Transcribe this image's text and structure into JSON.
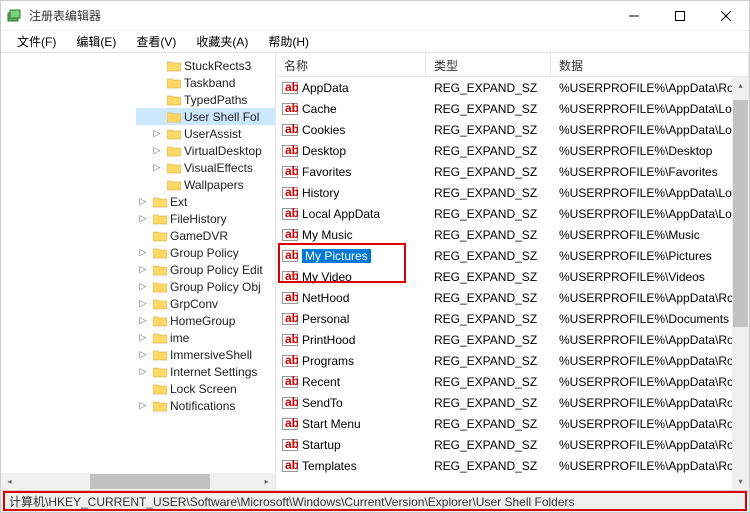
{
  "window": {
    "title": "注册表编辑器"
  },
  "menu": {
    "file": "文件(F)",
    "edit": "编辑(E)",
    "view": "查看(V)",
    "favorites": "收藏夹(A)",
    "help": "帮助(H)"
  },
  "tree": {
    "items": [
      {
        "label": "StuckRects3",
        "expandable": false,
        "indent": 2
      },
      {
        "label": "Taskband",
        "expandable": false,
        "indent": 2
      },
      {
        "label": "TypedPaths",
        "expandable": false,
        "indent": 2
      },
      {
        "label": "User Shell Fol",
        "expandable": false,
        "indent": 2,
        "selected": true
      },
      {
        "label": "UserAssist",
        "expandable": true,
        "indent": 2
      },
      {
        "label": "VirtualDesktop",
        "expandable": true,
        "indent": 2
      },
      {
        "label": "VisualEffects",
        "expandable": true,
        "indent": 2
      },
      {
        "label": "Wallpapers",
        "expandable": false,
        "indent": 2
      },
      {
        "label": "Ext",
        "expandable": true,
        "indent": 1
      },
      {
        "label": "FileHistory",
        "expandable": true,
        "indent": 1
      },
      {
        "label": "GameDVR",
        "expandable": false,
        "indent": 1
      },
      {
        "label": "Group Policy",
        "expandable": true,
        "indent": 1
      },
      {
        "label": "Group Policy Edit",
        "expandable": true,
        "indent": 1
      },
      {
        "label": "Group Policy Obj",
        "expandable": true,
        "indent": 1
      },
      {
        "label": "GrpConv",
        "expandable": true,
        "indent": 1
      },
      {
        "label": "HomeGroup",
        "expandable": true,
        "indent": 1
      },
      {
        "label": "ime",
        "expandable": true,
        "indent": 1
      },
      {
        "label": "ImmersiveShell",
        "expandable": true,
        "indent": 1
      },
      {
        "label": "Internet Settings",
        "expandable": true,
        "indent": 1
      },
      {
        "label": "Lock Screen",
        "expandable": false,
        "indent": 1
      },
      {
        "label": "Notifications",
        "expandable": true,
        "indent": 1
      }
    ]
  },
  "columns": {
    "name": "名称",
    "type": "类型",
    "data": "数据"
  },
  "values": [
    {
      "name": "AppData",
      "type": "REG_EXPAND_SZ",
      "data": "%USERPROFILE%\\AppData\\Roamin"
    },
    {
      "name": "Cache",
      "type": "REG_EXPAND_SZ",
      "data": "%USERPROFILE%\\AppData\\Local\\M"
    },
    {
      "name": "Cookies",
      "type": "REG_EXPAND_SZ",
      "data": "%USERPROFILE%\\AppData\\Local\\M"
    },
    {
      "name": "Desktop",
      "type": "REG_EXPAND_SZ",
      "data": "%USERPROFILE%\\Desktop"
    },
    {
      "name": "Favorites",
      "type": "REG_EXPAND_SZ",
      "data": "%USERPROFILE%\\Favorites"
    },
    {
      "name": "History",
      "type": "REG_EXPAND_SZ",
      "data": "%USERPROFILE%\\AppData\\Local\\M"
    },
    {
      "name": "Local AppData",
      "type": "REG_EXPAND_SZ",
      "data": "%USERPROFILE%\\AppData\\Local"
    },
    {
      "name": "My Music",
      "type": "REG_EXPAND_SZ",
      "data": "%USERPROFILE%\\Music"
    },
    {
      "name": "My Pictures",
      "type": "REG_EXPAND_SZ",
      "data": "%USERPROFILE%\\Pictures",
      "selected": true
    },
    {
      "name": "My Video",
      "type": "REG_EXPAND_SZ",
      "data": "%USERPROFILE%\\Videos"
    },
    {
      "name": "NetHood",
      "type": "REG_EXPAND_SZ",
      "data": "%USERPROFILE%\\AppData\\Roamin"
    },
    {
      "name": "Personal",
      "type": "REG_EXPAND_SZ",
      "data": "%USERPROFILE%\\Documents"
    },
    {
      "name": "PrintHood",
      "type": "REG_EXPAND_SZ",
      "data": "%USERPROFILE%\\AppData\\Roamin"
    },
    {
      "name": "Programs",
      "type": "REG_EXPAND_SZ",
      "data": "%USERPROFILE%\\AppData\\Roamin"
    },
    {
      "name": "Recent",
      "type": "REG_EXPAND_SZ",
      "data": "%USERPROFILE%\\AppData\\Roamin"
    },
    {
      "name": "SendTo",
      "type": "REG_EXPAND_SZ",
      "data": "%USERPROFILE%\\AppData\\Roamin"
    },
    {
      "name": "Start Menu",
      "type": "REG_EXPAND_SZ",
      "data": "%USERPROFILE%\\AppData\\Roamin"
    },
    {
      "name": "Startup",
      "type": "REG_EXPAND_SZ",
      "data": "%USERPROFILE%\\AppData\\Roamin"
    },
    {
      "name": "Templates",
      "type": "REG_EXPAND_SZ",
      "data": "%USERPROFILE%\\AppData\\Roamin"
    }
  ],
  "status": {
    "path": "计算机\\HKEY_CURRENT_USER\\Software\\Microsoft\\Windows\\CurrentVersion\\Explorer\\User Shell Folders"
  }
}
